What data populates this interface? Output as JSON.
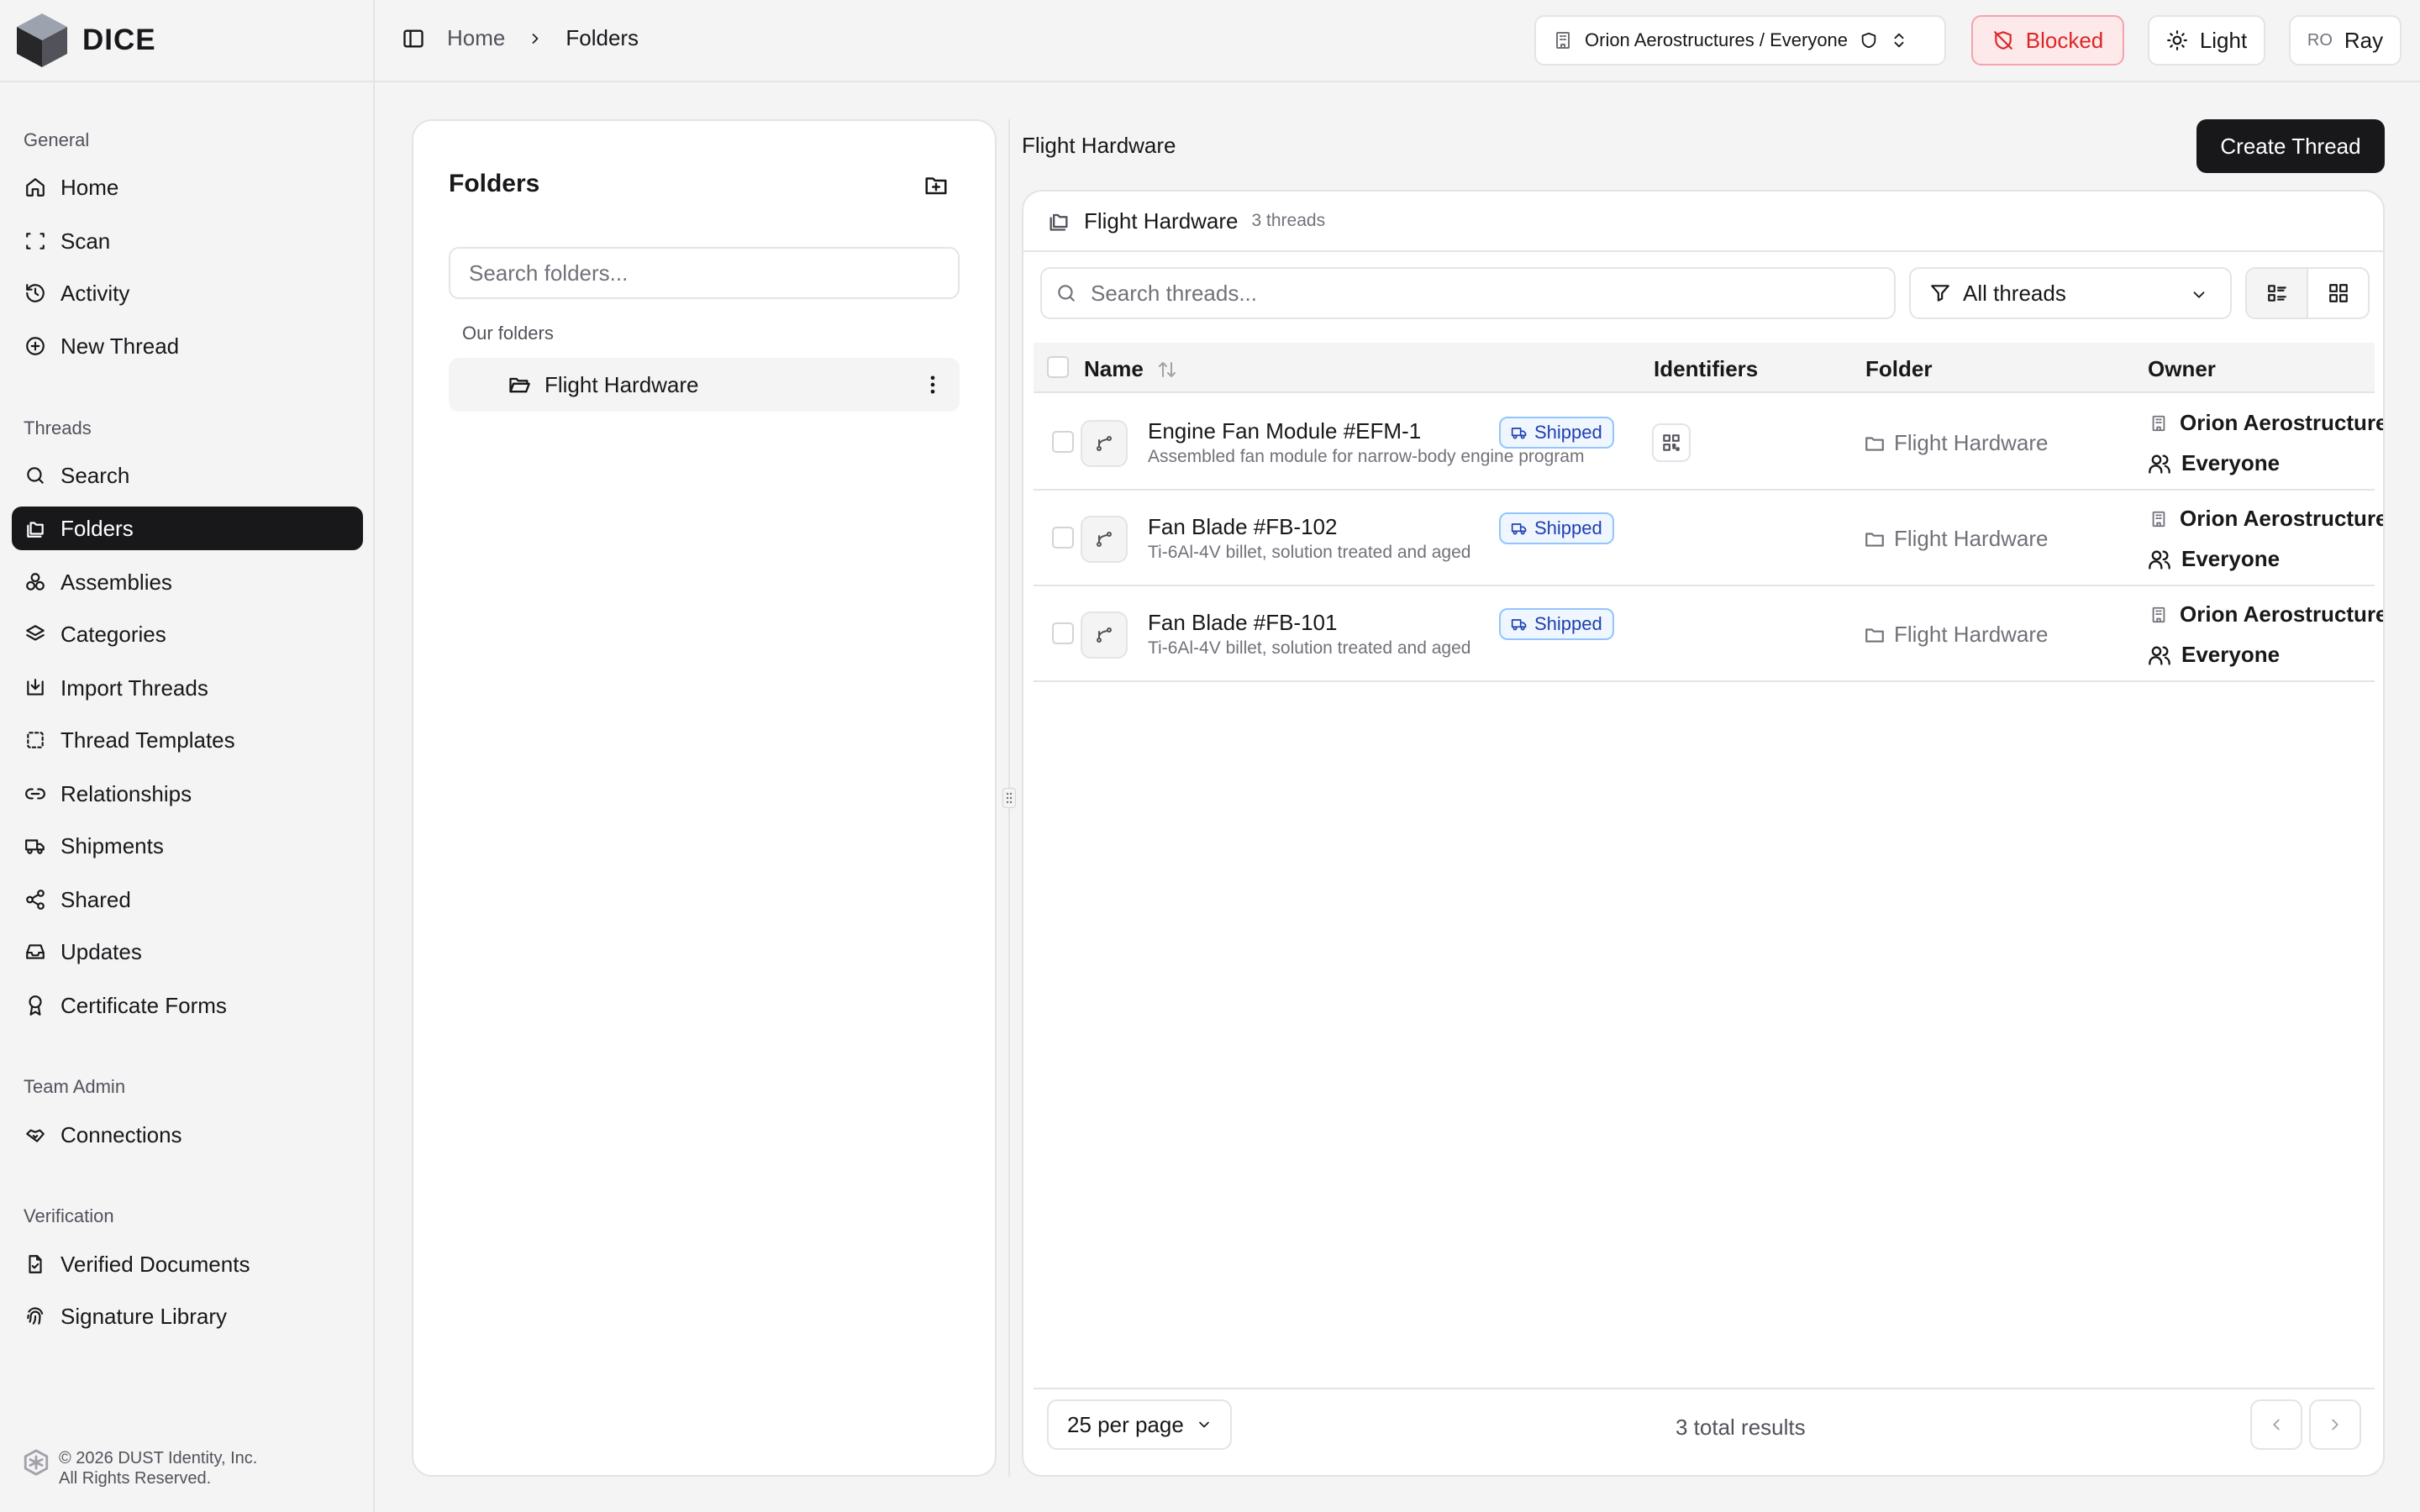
{
  "app": {
    "name": "DICE"
  },
  "sidebar": {
    "sections": [
      {
        "label": "General"
      },
      {
        "label": "Threads"
      },
      {
        "label": "Team Admin"
      },
      {
        "label": "Verification"
      }
    ],
    "items": [
      {
        "label": "Home",
        "icon": "home-icon"
      },
      {
        "label": "Scan",
        "icon": "scan-icon"
      },
      {
        "label": "Activity",
        "icon": "history-icon"
      },
      {
        "label": "New Thread",
        "icon": "plus-circle-icon"
      },
      {
        "label": "Search",
        "icon": "search-icon"
      },
      {
        "label": "Folders",
        "icon": "folders-icon",
        "active": true
      },
      {
        "label": "Assemblies",
        "icon": "assemblies-icon"
      },
      {
        "label": "Categories",
        "icon": "layers-icon"
      },
      {
        "label": "Import Threads",
        "icon": "import-icon"
      },
      {
        "label": "Thread Templates",
        "icon": "template-icon"
      },
      {
        "label": "Relationships",
        "icon": "link-icon"
      },
      {
        "label": "Shipments",
        "icon": "truck-icon"
      },
      {
        "label": "Shared",
        "icon": "share-icon"
      },
      {
        "label": "Updates",
        "icon": "inbox-icon"
      },
      {
        "label": "Certificate Forms",
        "icon": "award-icon"
      },
      {
        "label": "Connections",
        "icon": "handshake-icon"
      },
      {
        "label": "Verified Documents",
        "icon": "file-check-icon"
      },
      {
        "label": "Signature Library",
        "icon": "fingerprint-icon"
      }
    ],
    "footer": {
      "line1": "© 2026 DUST Identity, Inc.",
      "line2": "All Rights Reserved."
    }
  },
  "topbar": {
    "breadcrumb": [
      "Home",
      "Folders"
    ],
    "org_selector": "Orion Aerostructures / Everyone",
    "blocked_label": "Blocked",
    "theme_label": "Light",
    "user_initials": "RO",
    "user_name": "Ray"
  },
  "folders_panel": {
    "title": "Folders",
    "search_placeholder": "Search folders...",
    "group_label": "Our folders",
    "folders": [
      {
        "name": "Flight Hardware"
      }
    ]
  },
  "main": {
    "title": "Flight Hardware",
    "create_button": "Create Thread",
    "card": {
      "folder_name": "Flight Hardware",
      "thread_count": "3 threads",
      "search_placeholder": "Search threads...",
      "filter_value": "All threads",
      "columns": [
        "Name",
        "Identifiers",
        "Folder",
        "Owner"
      ],
      "rows": [
        {
          "name": "Engine Fan Module #EFM-1",
          "desc": "Assembled fan module for narrow-body engine program",
          "status": "Shipped",
          "has_identifier": true,
          "folder": "Flight Hardware",
          "owner_org": "Orion Aerostructures",
          "owner_group": "Everyone"
        },
        {
          "name": "Fan Blade #FB-102",
          "desc": "Ti-6Al-4V billet, solution treated and aged",
          "status": "Shipped",
          "has_identifier": false,
          "folder": "Flight Hardware",
          "owner_org": "Orion Aerostructures",
          "owner_group": "Everyone"
        },
        {
          "name": "Fan Blade #FB-101",
          "desc": "Ti-6Al-4V billet, solution treated and aged",
          "status": "Shipped",
          "has_identifier": false,
          "folder": "Flight Hardware",
          "owner_org": "Orion Aerostructures",
          "owner_group": "Everyone"
        }
      ],
      "per_page": "25 per page",
      "total_results": "3 total results"
    }
  },
  "colors": {
    "accent_dark": "#18181b",
    "blocked_red": "#dc2626",
    "shipped_blue": "#1e40af"
  }
}
